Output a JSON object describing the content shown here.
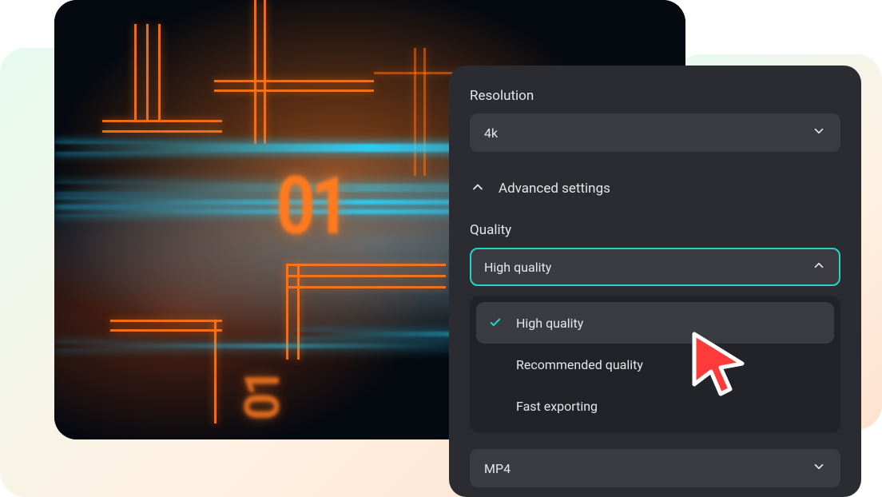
{
  "panel": {
    "resolution_label": "Resolution",
    "resolution_value": "4k",
    "advanced_label": "Advanced settings",
    "quality_label": "Quality",
    "quality_value": "High quality",
    "quality_options": {
      "opt0": "High quality",
      "opt1": "Recommended quality",
      "opt2": "Fast exporting"
    },
    "format_value": "MP4"
  },
  "colors": {
    "accent": "#1fd6c8",
    "panel": "#2b2c31"
  }
}
